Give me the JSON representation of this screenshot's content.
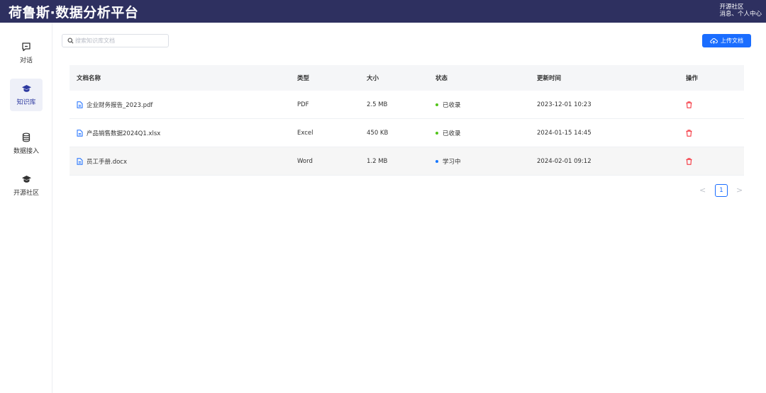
{
  "header": {
    "title": "荷鲁斯·数据分析平台",
    "links": [
      "开源社区",
      "消息",
      "个人中心"
    ],
    "separator": "、"
  },
  "sidebar": {
    "items": [
      {
        "label": "对话",
        "icon": "chat-icon",
        "active": false
      },
      {
        "label": "知识库",
        "icon": "graduation-cap-icon",
        "active": true
      },
      {
        "label": "数据接入",
        "icon": "database-icon",
        "active": false
      },
      {
        "label": "开源社区",
        "icon": "graduation-cap-icon",
        "active": false
      }
    ]
  },
  "toolbar": {
    "search_placeholder": "搜索知识库文档",
    "search_value": "",
    "upload_label": "上传文档"
  },
  "table": {
    "columns": [
      "文档名称",
      "类型",
      "大小",
      "状态",
      "更新时间",
      "操作"
    ],
    "rows": [
      {
        "name": "企业财务报告_2023.pdf",
        "type": "PDF",
        "size": "2.5 MB",
        "status": "已收录",
        "status_color": "#52c41a",
        "updated": "2023-12-01 10:23"
      },
      {
        "name": "产品销售数据2024Q1.xlsx",
        "type": "Excel",
        "size": "450 KB",
        "status": "已收录",
        "status_color": "#52c41a",
        "updated": "2024-01-15 14:45"
      },
      {
        "name": "员工手册.docx",
        "type": "Word",
        "size": "1.2 MB",
        "status": "学习中",
        "status_color": "#1677ff",
        "updated": "2024-02-01 09:12"
      }
    ]
  },
  "pagination": {
    "current": "1",
    "prev": "<",
    "next": ">"
  },
  "colors": {
    "header_bg": "#2e3060",
    "primary": "#1a6dff",
    "danger": "#f5222d"
  }
}
